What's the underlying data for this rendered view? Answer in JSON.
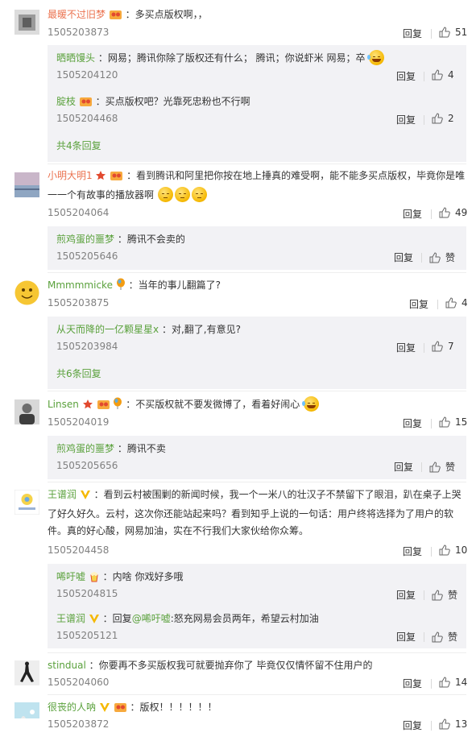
{
  "labels": {
    "reply": "回复",
    "like": "赞"
  },
  "comments": [
    {
      "user": "最暖不过旧梦",
      "text": "：多买点版权啊，，",
      "time": "1505203873",
      "likes": "51",
      "subs": [
        {
          "user": "晒晒馒头",
          "text": "：网易；腾讯你除了版权还有什么；   腾讯；你说虾米   网易；卒",
          "time": "1505204120",
          "likes": "4"
        },
        {
          "user": "腚枝",
          "text": "：买点版权吧？光靠死忠粉也不行啊",
          "time": "1505204468",
          "likes": "2"
        }
      ],
      "more": "共4条回复"
    },
    {
      "user": "小明大明1",
      "text_line1": "：看到腾讯和阿里把你按在地上捶真的难受啊，能不能多买点版权，毕竟你是唯",
      "text_line2": "一一个有故事的播放器啊",
      "time": "1505204064",
      "likes": "49",
      "subs": [
        {
          "user": "煎鸡蛋的噩梦",
          "text": "：腾讯不会卖的",
          "time": "1505205646",
          "likes": "赞"
        }
      ]
    },
    {
      "user": "Mmmmmicke",
      "text": "：当年的事儿翻篇了?",
      "time": "1505203875",
      "likes": "4",
      "subs": [
        {
          "user": "从天而降的一亿颗星星x",
          "text": "：对,翻了,有意见?",
          "time": "1505203984",
          "likes": "7"
        }
      ],
      "more": "共6条回复"
    },
    {
      "user": "Linsen",
      "text": "：不买版权就不要发微博了，看着好闹心",
      "time": "1505204019",
      "likes": "15",
      "subs": [
        {
          "user": "煎鸡蛋的噩梦",
          "text": "：腾讯不卖",
          "time": "1505205656",
          "likes": "赞"
        }
      ]
    },
    {
      "user": "王谱润",
      "text_line1": "：看到云村被围剿的新闻时候，我一个一米八的壮汉子不禁留下了眼泪，趴在桌子上哭",
      "text_line2": "了好久好久。云村，这次你还能站起来吗？看到知乎上说的一句话：用户终将选择为了用户的软",
      "text_line3": "件。真的好心酸，网易加油，实在不行我们大家伙给你众筹。",
      "time": "1505204458",
      "likes": "10",
      "subs": [
        {
          "user": "唏吁嘘",
          "text": "：内啥 你戏好多哦",
          "time": "1505204815",
          "likes": "赞"
        },
        {
          "user": "王谱润",
          "text_pre": "：回复",
          "mention": "@唏吁嘘",
          "text": ":怒充网易会员两年，希望云村加油",
          "time": "1505205121",
          "likes": "赞"
        }
      ]
    },
    {
      "user": "stindual",
      "text": "：你要再不多买版权我可就要抛弃你了 毕竟仅仅情怀留不住用户的",
      "time": "1505204060",
      "likes": "14"
    },
    {
      "user": "很丧的人呐",
      "text": "：版权！！！！！！",
      "time": "1505203872",
      "likes": "13"
    }
  ],
  "colors": {
    "username": "#eb7350",
    "sub_username": "#5aa13c",
    "sub_bg": "#f2f2f5",
    "meta": "#808080"
  }
}
